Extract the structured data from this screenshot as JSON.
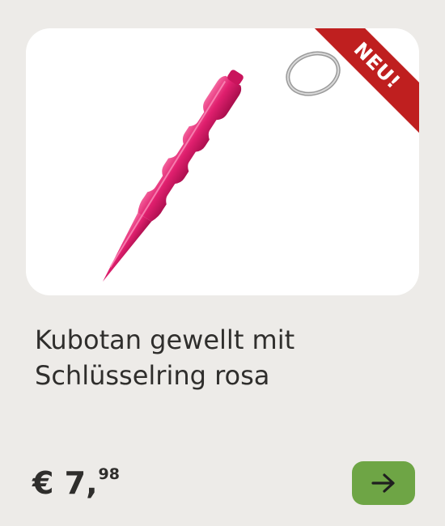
{
  "product": {
    "badge": "NEU!",
    "title_line1": "Kubotan gewellt mit",
    "title_line2": "Schlüsselring rosa",
    "price_main": "€ 7,",
    "price_cents": "98",
    "image_alt": "pink wavy kubotan keychain",
    "next_icon": "arrow-right-icon"
  },
  "colors": {
    "badge": "#bf1f1f",
    "button": "#6ea545",
    "product": "#e01f6e",
    "background": "#edebe8"
  }
}
